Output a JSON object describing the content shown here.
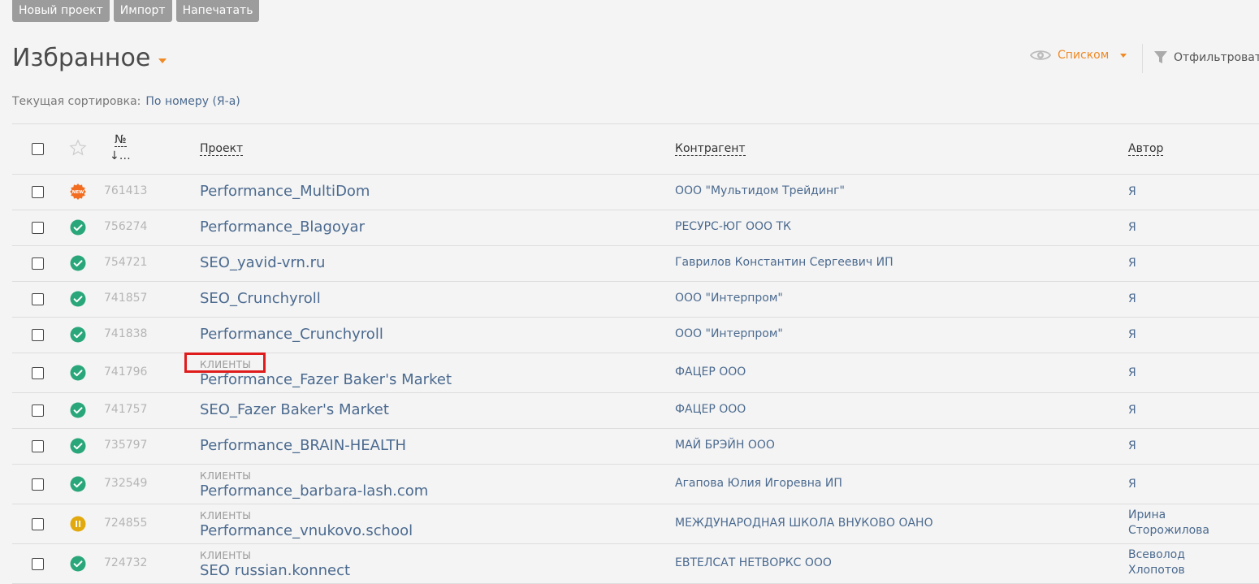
{
  "toolbar": {
    "new_project": "Новый проект",
    "import": "Импорт",
    "print": "Напечатать"
  },
  "page": {
    "title": "Избранное"
  },
  "view": {
    "label": "Списком"
  },
  "filter": {
    "label": "Отфильтровать"
  },
  "sort": {
    "label": "Текущая сортировка:",
    "value": "По номеру (Я-а)"
  },
  "columns": {
    "number": "№",
    "number_sort": "↓…",
    "project": "Проект",
    "counterparty": "Контрагент",
    "author": "Автор"
  },
  "colors": {
    "accent": "#ef8a26",
    "link": "#4b6a8f",
    "status_done": "#2aa77a",
    "status_paused": "#e1a90e",
    "status_new": "#f36d21",
    "highlight": "#e01b1b"
  },
  "rows": [
    {
      "status": "new",
      "status_icon": "new-badge-icon",
      "status_text": "NEW",
      "number": "761413",
      "category": "",
      "project": "Performance_MultiDom",
      "counterparty": "ООО \"Мультидом Трейдинг\"",
      "author": "Я"
    },
    {
      "status": "done",
      "status_icon": "check-circle-icon",
      "number": "756274",
      "category": "",
      "project": "Performance_Blagoyar",
      "counterparty": "РЕСУРС-ЮГ ООО ТК",
      "author": "Я"
    },
    {
      "status": "done",
      "status_icon": "check-circle-icon",
      "number": "754721",
      "category": "",
      "project": "SEO_yavid-vrn.ru",
      "counterparty": "Гаврилов Константин Сергеевич ИП",
      "author": "Я"
    },
    {
      "status": "done",
      "status_icon": "check-circle-icon",
      "number": "741857",
      "category": "",
      "project": "SEO_Crunchyroll",
      "counterparty": "ООО \"Интерпром\"",
      "author": "Я"
    },
    {
      "status": "done",
      "status_icon": "check-circle-icon",
      "number": "741838",
      "category": "",
      "project": "Performance_Crunchyroll",
      "counterparty": "ООО \"Интерпром\"",
      "author": "Я"
    },
    {
      "status": "done",
      "status_icon": "check-circle-icon",
      "number": "741796",
      "category": "КЛИЕНТЫ",
      "project": "Performance_Fazer Baker's Market",
      "counterparty": "ФАЦЕР ООО",
      "author": "Я"
    },
    {
      "status": "done",
      "status_icon": "check-circle-icon",
      "number": "741757",
      "category": "",
      "project": "SEO_Fazer Baker's Market",
      "counterparty": "ФАЦЕР ООО",
      "author": "Я"
    },
    {
      "status": "done",
      "status_icon": "check-circle-icon",
      "number": "735797",
      "category": "",
      "project": "Performance_BRAIN-HEALTH",
      "counterparty": "МАЙ БРЭЙН ООО",
      "author": "Я"
    },
    {
      "status": "done",
      "status_icon": "check-circle-icon",
      "number": "732549",
      "category": "КЛИЕНТЫ",
      "project": "Performance_barbara-lash.com",
      "counterparty": "Агапова Юлия Игоревна ИП",
      "author": "Я"
    },
    {
      "status": "paused",
      "status_icon": "pause-circle-icon",
      "number": "724855",
      "category": "КЛИЕНТЫ",
      "project": "Performance_vnukovo.school",
      "counterparty": "МЕЖДУНАРОДНАЯ ШКОЛА ВНУКОВО ОАНО",
      "author": "Ирина Сторожилова"
    },
    {
      "status": "done",
      "status_icon": "check-circle-icon",
      "number": "724732",
      "category": "КЛИЕНТЫ",
      "project": "SEO russian.konnect",
      "counterparty": "ЕВТЕЛСАТ НЕТВОРКС ООО",
      "author": "Всеволод Хлопотов"
    }
  ]
}
